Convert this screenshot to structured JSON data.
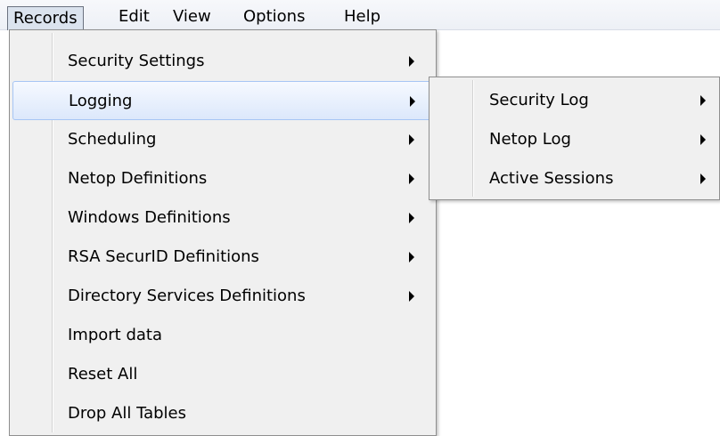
{
  "menubar": {
    "items": [
      {
        "label": "Records"
      },
      {
        "label": "Edit"
      },
      {
        "label": "View"
      },
      {
        "label": "Options"
      },
      {
        "label": "Help"
      }
    ]
  },
  "records_menu": {
    "items": [
      {
        "label": "Security Settings",
        "submenu": true
      },
      {
        "label": "Logging",
        "submenu": true,
        "highlighted": true
      },
      {
        "label": "Scheduling",
        "submenu": true
      },
      {
        "label": "Netop Definitions",
        "submenu": true
      },
      {
        "label": "Windows Definitions",
        "submenu": true
      },
      {
        "label": "RSA SecurID Definitions",
        "submenu": true
      },
      {
        "label": "Directory Services Definitions",
        "submenu": true
      },
      {
        "label": "Import data",
        "submenu": false
      },
      {
        "label": "Reset All",
        "submenu": false
      },
      {
        "label": "Drop All Tables",
        "submenu": false
      }
    ]
  },
  "logging_submenu": {
    "items": [
      {
        "label": "Security Log",
        "submenu": true
      },
      {
        "label": "Netop Log",
        "submenu": true
      },
      {
        "label": "Active Sessions",
        "submenu": true
      }
    ]
  },
  "colors": {
    "menu_background": "#f0f0f0",
    "highlight_border": "#a6c5f4",
    "highlight_fill": "#dce8fb"
  }
}
